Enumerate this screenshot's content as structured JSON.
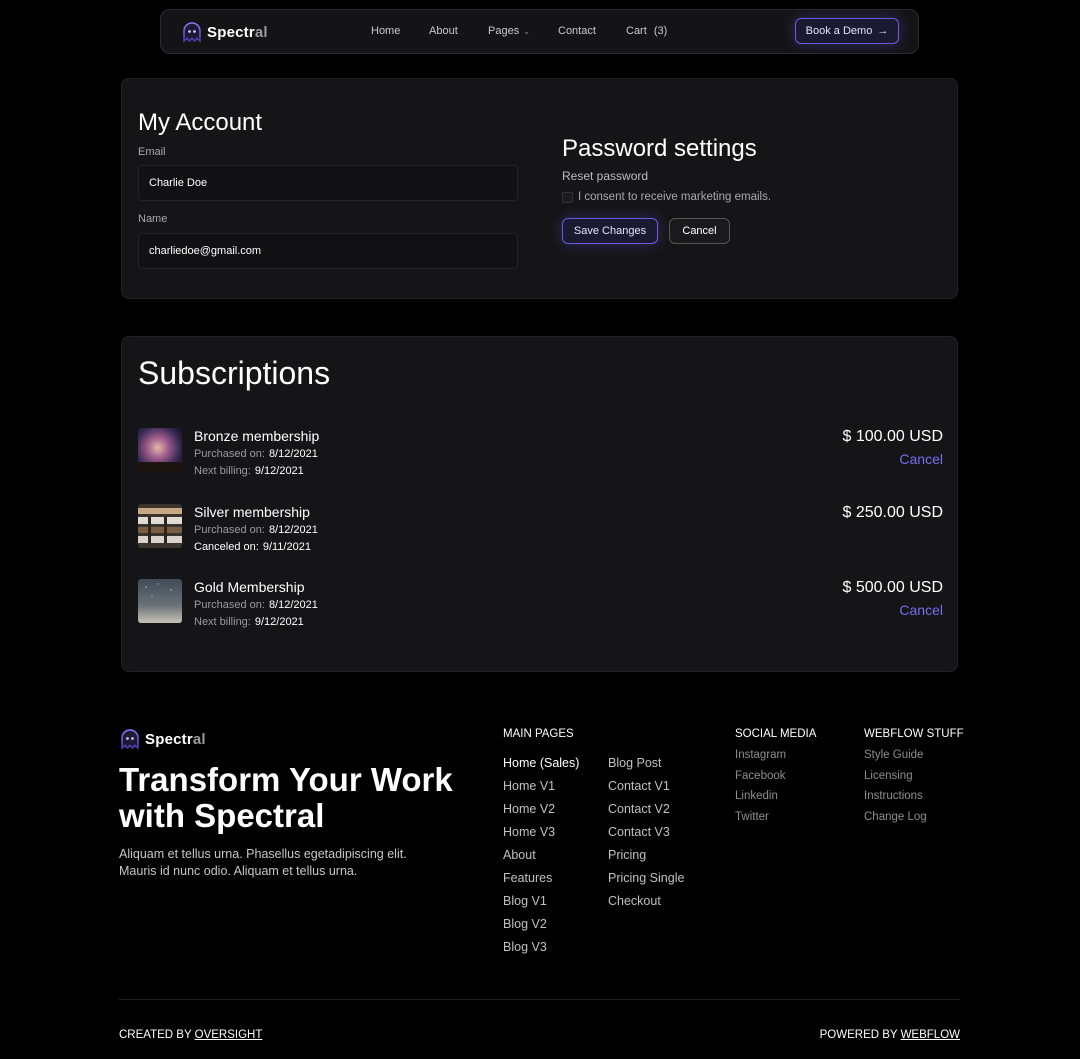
{
  "nav": {
    "brand_main": "Spectr",
    "brand_fade": "al",
    "links": [
      "Home",
      "About",
      "Pages",
      "Contact"
    ],
    "cart_label": "Cart",
    "cart_count": "(3)",
    "demo_label": "Book a Demo"
  },
  "account": {
    "title": "My Account",
    "email_label": "Email",
    "email_value": "Charlie Doe",
    "name_label": "Name",
    "name_value": "charliedoe@gmail.com"
  },
  "password": {
    "title": "Password settings",
    "reset_label": "Reset password",
    "consent_label": "I consent to receive marketing emails.",
    "save_label": "Save Changes",
    "cancel_label": "Cancel"
  },
  "subscriptions": {
    "title": "Subscriptions",
    "items": [
      {
        "name": "Bronze membership",
        "line1_label": "Purchased on:",
        "line1_value": "8/12/2021",
        "line2_label": "Next billing:",
        "line2_value": "9/12/2021",
        "price": "$ 100.00 USD",
        "cancel": "Cancel"
      },
      {
        "name": "Silver membership",
        "line1_label": "Purchased on:",
        "line1_value": "8/12/2021",
        "line2_label": "Canceled on:",
        "line2_value": "9/11/2021",
        "price": "$ 250.00 USD",
        "cancel": ""
      },
      {
        "name": "Gold Membership",
        "line1_label": "Purchased on:",
        "line1_value": "8/12/2021",
        "line2_label": "Next billing:",
        "line2_value": "9/12/2021",
        "price": "$ 500.00 USD",
        "cancel": "Cancel"
      }
    ]
  },
  "footer": {
    "brand_main": "Spectr",
    "brand_fade": "al",
    "headline": "Transform Your Work with Spectral",
    "description": "Aliquam et tellus urna. Phasellus egetadipiscing elit. Mauris id nunc odio. Aliquam et tellus urna.",
    "main_pages_heading": "MAIN PAGES",
    "main_pages_col1": [
      "Home (Sales)",
      "Home V1",
      "Home V2",
      "Home V3",
      "About",
      "Features",
      "Blog V1",
      "Blog V2",
      "Blog V3"
    ],
    "main_pages_col2": [
      "Blog Post",
      "Contact V1",
      "Contact V2",
      "Contact V3",
      "Pricing",
      "Pricing Single",
      "Checkout"
    ],
    "social_heading": "SOCIAL MEDIA",
    "social_links": [
      "Instagram",
      "Facebook",
      "Linkedin",
      "Twitter"
    ],
    "webflow_heading": "WEBFLOW STUFF",
    "webflow_links": [
      "Style Guide",
      "Licensing",
      "Instructions",
      "Change Log"
    ],
    "created_prefix": "CREATED BY",
    "created_link": "OVERSIGHT",
    "powered_prefix": "POWERED BY",
    "powered_link": "WEBFLOW"
  }
}
